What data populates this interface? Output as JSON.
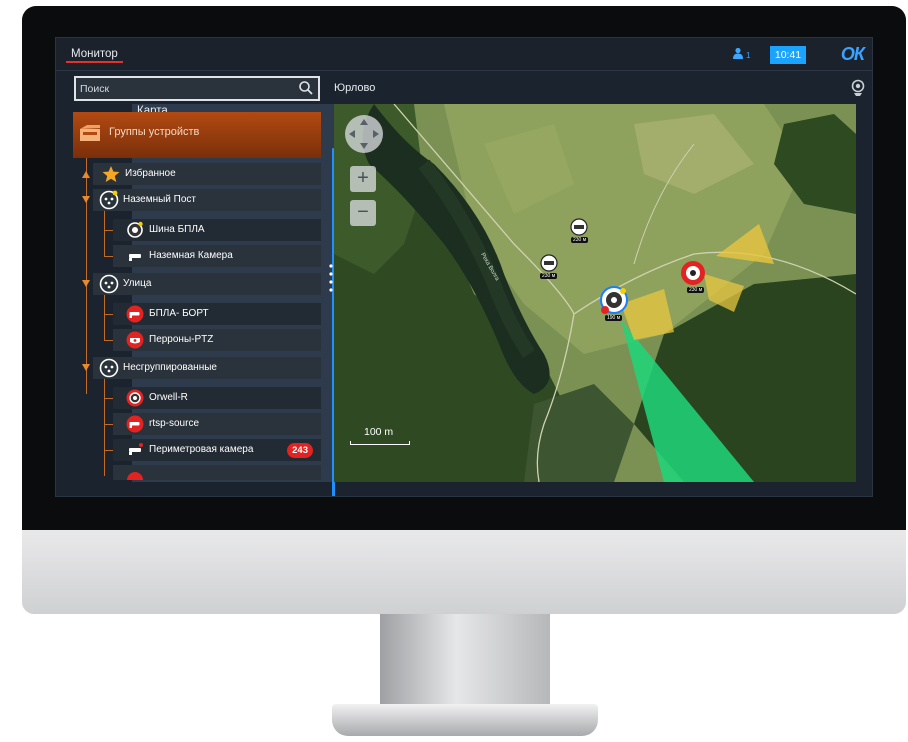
{
  "app": {
    "tabs": [
      {
        "label": "Монитор",
        "active": true
      },
      {
        "label": "Карта",
        "active": false
      }
    ],
    "user_count": "1",
    "time": "10:41",
    "brand": "ОК"
  },
  "sidebar": {
    "search_placeholder": "Поиск",
    "groups_label": "Группы устройств",
    "items": [
      {
        "label": "Избранное",
        "icon": "star-icon",
        "level": 0,
        "expandable": true
      },
      {
        "label": "Наземный Пост",
        "icon": "camera-group-icon",
        "level": 0,
        "expandable": true
      },
      {
        "label": "Шина БПЛА",
        "icon": "drone-camera-icon",
        "level": 1
      },
      {
        "label": "Наземная Камера",
        "icon": "bullet-camera-icon",
        "level": 1
      },
      {
        "label": "Улица",
        "icon": "camera-group-icon",
        "level": 0,
        "expandable": true
      },
      {
        "label": "БПЛА- БОРТ",
        "icon": "bullet-camera-icon",
        "level": 1
      },
      {
        "label": "Перроны-PTZ",
        "icon": "ptz-camera-icon",
        "level": 1
      },
      {
        "label": "Несгруппированные",
        "icon": "camera-group-icon",
        "level": 0,
        "expandable": true
      },
      {
        "label": "Orwell-R",
        "icon": "drone-camera-icon",
        "level": 1
      },
      {
        "label": "rtsp-source",
        "icon": "bullet-camera-icon",
        "level": 1
      },
      {
        "label": "Периметровая камера",
        "icon": "bullet-camera-icon",
        "level": 1,
        "badge": "243"
      }
    ]
  },
  "map": {
    "location": "Юрлово",
    "scale": "100 m",
    "river_label": "Река Волга",
    "markers": [
      {
        "label": "230 м"
      },
      {
        "label": "230 м"
      },
      {
        "label": "190 м"
      },
      {
        "label": "230 м"
      }
    ]
  },
  "colors": {
    "accent_orange": "#c36a23",
    "accent_blue": "#1aa3ff",
    "alert_red": "#e32222",
    "fov_green": "#1fd67a",
    "fov_yellow": "#e8c640"
  }
}
